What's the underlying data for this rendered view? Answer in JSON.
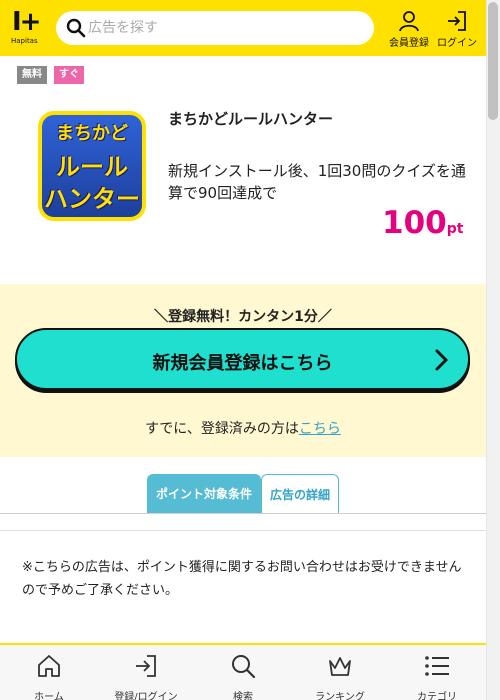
{
  "header": {
    "logo_mark": "I+",
    "logo_word": "Hapitas",
    "search_placeholder": "広告を探す",
    "register_label": "会員登録",
    "login_label": "ログイン"
  },
  "tags": {
    "free": "無料",
    "soon": "すぐ"
  },
  "app": {
    "icon_text": [
      "まちかど",
      "ルール",
      "ハンター"
    ],
    "title": "まちかどルールハンター",
    "description": "新規インストール後、1回30問のクイズを通算で90回達成で",
    "points_value": "100",
    "points_unit": "pt"
  },
  "registration": {
    "catch": "＼登録無料！カンタン1分／",
    "cta_label": "新規会員登録はこちら",
    "already_text": "すでに、登録済みの方は",
    "already_link": "こちら"
  },
  "tabs": {
    "active": "ポイント対象条件",
    "detail": "広告の詳細"
  },
  "notice": "※こちらの広告は、ポイント獲得に関するお問い合わせはお受けできませんので予めご了承ください。",
  "bottom_nav": {
    "home": "ホーム",
    "login": "登録/ログイン",
    "search": "検索",
    "ranking": "ランキング",
    "category": "カテゴリ"
  },
  "colors": {
    "brand_yellow": "#ffe100",
    "cta_teal": "#1fe0cf",
    "points_pink": "#e4007f",
    "tab_blue": "#55bcd3"
  }
}
